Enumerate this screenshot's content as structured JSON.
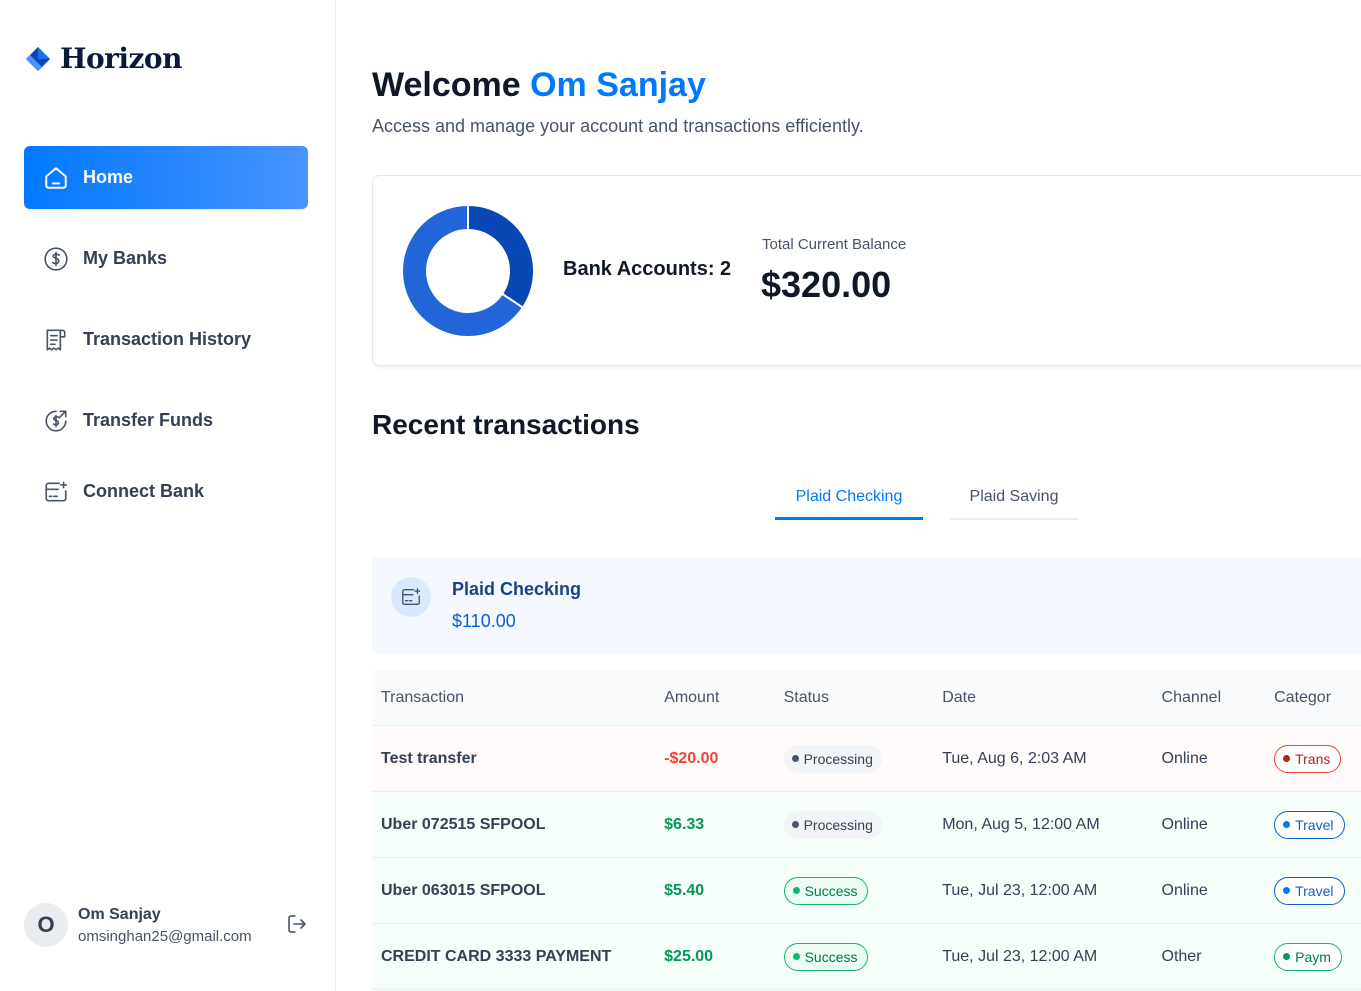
{
  "brand": {
    "name": "Horizon"
  },
  "sidebar": {
    "items": [
      {
        "label": "Home",
        "icon": "home-icon",
        "active": true
      },
      {
        "label": "My Banks",
        "icon": "dollar-circle-icon"
      },
      {
        "label": "Transaction History",
        "icon": "receipt-icon"
      },
      {
        "label": "Transfer Funds",
        "icon": "money-send-icon"
      },
      {
        "label": "Connect Bank",
        "icon": "card-add-icon"
      }
    ],
    "user": {
      "initial": "O",
      "name": "Om Sanjay",
      "email": "omsinghan25@gmail.com"
    }
  },
  "header": {
    "welcome_prefix": "Welcome",
    "user_name": "Om Sanjay",
    "subtitle": "Access and manage your account and transactions efficiently."
  },
  "balance": {
    "bank_accounts_text": "Bank Accounts: 2",
    "total_label": "Total Current Balance",
    "total_value": "$320.00"
  },
  "chart_data": {
    "type": "pie",
    "categories": [
      "Plaid Checking",
      "Plaid Saving"
    ],
    "values": [
      110,
      210
    ],
    "colors": [
      "#0747b6",
      "#2265d8"
    ]
  },
  "recent": {
    "title": "Recent transactions",
    "tabs": [
      {
        "label": "Plaid Checking",
        "active": true
      },
      {
        "label": "Plaid Saving",
        "active": false
      }
    ],
    "selected_bank": {
      "name": "Plaid Checking",
      "balance": "$110.00"
    },
    "columns": [
      "Transaction",
      "Amount",
      "Status",
      "Date",
      "Channel",
      "Categor"
    ],
    "rows": [
      {
        "name": "Test transfer",
        "amount": "-$20.00",
        "status": "Processing",
        "date": "Tue, Aug 6, 2:03 AM",
        "channel": "Online",
        "category": "Trans",
        "type": "debit",
        "cat_color": "red"
      },
      {
        "name": "Uber 072515 SFPOOL",
        "amount": "$6.33",
        "status": "Processing",
        "date": "Mon, Aug 5, 12:00 AM",
        "channel": "Online",
        "category": "Travel",
        "type": "credit",
        "cat_color": "blue"
      },
      {
        "name": "Uber 063015 SFPOOL",
        "amount": "$5.40",
        "status": "Success",
        "date": "Tue, Jul 23, 12:00 AM",
        "channel": "Online",
        "category": "Travel",
        "type": "credit",
        "cat_color": "blue"
      },
      {
        "name": "CREDIT CARD 3333 PAYMENT",
        "amount": "$25.00",
        "status": "Success",
        "date": "Tue, Jul 23, 12:00 AM",
        "channel": "Other",
        "category": "Paym",
        "type": "credit",
        "cat_color": "green"
      }
    ]
  },
  "colors": {
    "accent": "#0179fe",
    "positive": "#039855",
    "negative": "#f04438"
  }
}
